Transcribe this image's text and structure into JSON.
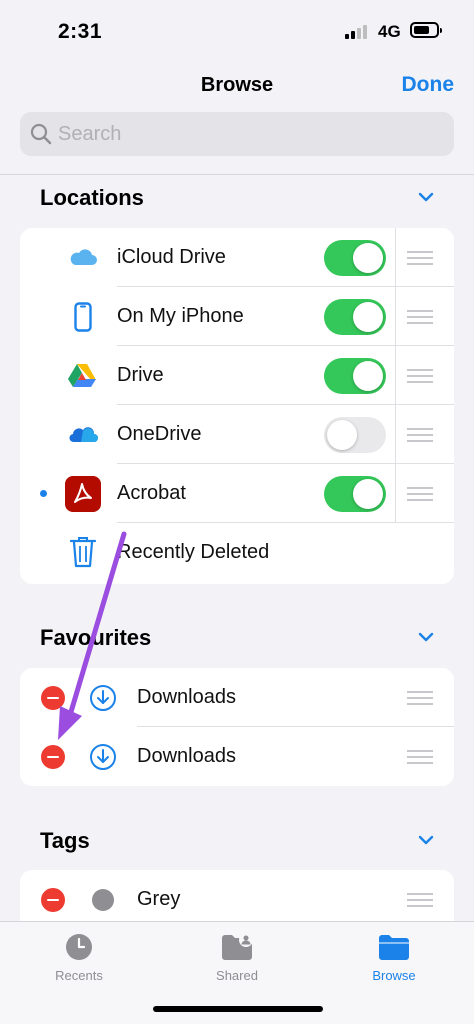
{
  "status": {
    "time": "2:31",
    "network": "4G"
  },
  "nav": {
    "title": "Browse",
    "done": "Done"
  },
  "search": {
    "placeholder": "Search"
  },
  "locations": {
    "title": "Locations",
    "items": [
      {
        "label": "iCloud Drive",
        "icon": "icloud-icon",
        "enabled": true
      },
      {
        "label": "On My iPhone",
        "icon": "iphone-icon",
        "enabled": true
      },
      {
        "label": "Drive",
        "icon": "google-drive-icon",
        "enabled": true
      },
      {
        "label": "OneDrive",
        "icon": "onedrive-icon",
        "enabled": false
      },
      {
        "label": "Acrobat",
        "icon": "acrobat-icon",
        "enabled": true,
        "dot": true
      },
      {
        "label": "Recently Deleted",
        "icon": "trash-icon"
      }
    ]
  },
  "favourites": {
    "title": "Favourites",
    "items": [
      {
        "label": "Downloads",
        "icon": "download-icon"
      },
      {
        "label": "Downloads",
        "icon": "download-icon"
      }
    ]
  },
  "tags": {
    "title": "Tags",
    "items": [
      {
        "label": "Grey",
        "color": "#8e8e93"
      }
    ]
  },
  "tabs": [
    {
      "label": "Recents",
      "icon": "clock-icon",
      "active": false
    },
    {
      "label": "Shared",
      "icon": "shared-folder-icon",
      "active": false
    },
    {
      "label": "Browse",
      "icon": "folder-icon",
      "active": true
    }
  ],
  "colors": {
    "accent": "#1a82e8",
    "toggle_on": "#34c759",
    "delete": "#ee3b32",
    "annotation_arrow": "#9b4de0"
  }
}
